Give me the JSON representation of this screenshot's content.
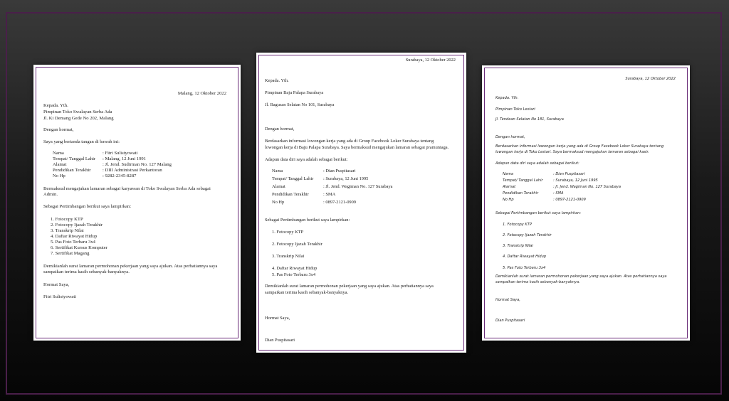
{
  "letter1": {
    "date": "Malang, 12 Oktober 2022",
    "to_label": "Kepada. Yth.",
    "recipient": "Pimpinan Toko Swalayan Serba Ada",
    "address": "Jl. Ki Demang Gede No 202, Malang",
    "greeting": "Dengan hormat,",
    "intro": "Saya yang bertanda tangan di bawah ini:",
    "fields": [
      {
        "label": "Nama",
        "value": ": Fitri Sulistyowati"
      },
      {
        "label": "Tempat/ Tanggal Lahir",
        "value": ": Malang, 12 Juni 1991"
      },
      {
        "label": "Alamat",
        "value": ": Jl. Jend. Sudirman No. 127 Malang"
      },
      {
        "label": "Pendidikan Terakhir",
        "value": ": DIII Administrasi Perkantoran"
      },
      {
        "label": "No Hp",
        "value": ": 9282-2345-8287"
      }
    ],
    "body_line1": "Bermaksud mengajukan lamaran sebagai karyawan di Toko Swalayan Serba Ada sebagai",
    "body_line2": "Admin.",
    "attach_intro": "Sebagai Pertimbangan berikut saya lampirkan:",
    "attachments": [
      "1.  Fotocopy KTP",
      "2.  Fotocopy Ijazah Terakhir",
      "3.  Transkrip Nilai",
      "4.  Daftar Riwayat Hidup",
      "5.  Pas Foto Terbaru 3x4",
      "6.  Sertifikat Kursus Komputer",
      "7.  Sertifikat Magang"
    ],
    "closing_line1": "Demikianlah surat lamaran permohonan pekerjaan yang saya ajukan. Atas perhatiannya saya",
    "closing_line2": "sampaikan terima kasih sebanyak-banyaknya.",
    "regards": "Hormat Saya,",
    "signature": "Fitri Sulistyowati"
  },
  "letter2": {
    "date": "Surabaya, 12 Oktober 2022",
    "to_label": "Kepada. Yth.",
    "recipient": "Pimpinan Baju Palapa Surabaya",
    "address": "Jl. Bagusan Selatan No 101, Surabaya",
    "greeting": "Dengan hormat,",
    "body_line1": "Berdasarkan informasi lowongan kerja yang ada di Group Facebook Loker Surabaya tentang",
    "body_line2": "lowongan kerja di Baju Palapa Surabaya. Saya bermaksud mengajukan lamaran sebagai pramuniaga.",
    "intro": "Adapun data diri saya adalah sebagai berikut:",
    "fields": [
      {
        "label": "Nama",
        "value": ": Dian Puspitasari"
      },
      {
        "label": "Tempat/ Tanggal Lahir",
        "value": ": Surabaya, 12 Juni 1995"
      },
      {
        "label": "Alamat",
        "value": ": Jl. Jend. Wagiman No. 127 Surabaya"
      },
      {
        "label": "Pendidikan Terakhir",
        "value": ": SMA"
      },
      {
        "label": "No Hp",
        "value": ": 0897-2121-0909"
      }
    ],
    "attach_intro": "Sebagai Pertimbangan berikut saya lampirkan:",
    "attachments": [
      "1.  Fotocopy KTP",
      "2.  Fotocopy Ijazah Terakhir",
      "3.  Transkrip Nilai",
      "4.  Daftar Riwayat Hidup",
      "5.  Pas Foto Terbaru 3x4"
    ],
    "closing_line1": "Demikianlah surat lamaran permohonan pekerjaan yang saya ajukan. Atas perhatiannya saya",
    "closing_line2": "sampaikan terima kasih sebanyak-banyaknya.",
    "regards": "Hormat Saya,",
    "signature": "Dian Puspitasari"
  },
  "letter3": {
    "date": "Surabaya, 12 Oktober 2022",
    "to_label": "Kepada. Yth.",
    "recipient": "Pimpinan Toko Lestari",
    "address": "Jl. Tendean Selatan No 181, Surabaya",
    "greeting": "Dengan hormat,",
    "body_line1": "Berdasarkan informasi lowongan kerja yang ada di Group Facebook Loker Surabaya tentang",
    "body_line2": "lowongan kerja di Toko Lestari. Saya bermaksud mengajukan lamaran sebagai kasir.",
    "intro": "Adapun data diri saya adalah sebagai berikut:",
    "fields": [
      {
        "label": "Nama",
        "value": ": Dian Puspitasari"
      },
      {
        "label": "Tempat/ Tanggal Lahir",
        "value": ": Surabaya, 12 Juni 1995"
      },
      {
        "label": "Alamat",
        "value": ": Jl. Jend. Wagiman No. 127 Surabaya"
      },
      {
        "label": "Pendidikan Terakhir",
        "value": ": SMA"
      },
      {
        "label": "No Hp",
        "value": ": 0897-2121-0909"
      }
    ],
    "attach_intro": "Sebagai Pertimbangan berikut saya lampirkan:",
    "attachments": [
      "1.  Fotocopy KTP",
      "2.  Fotocopy Ijazah Terakhir",
      "3.  Transkrip Nilai",
      "4.  Daftar Riwayat Hidup",
      "5.  Pas Foto Terbaru 3x4"
    ],
    "closing_line1": "Demikianlah surat lamaran permohonan pekerjaan yang saya ajukan. Atas perhatiannya saya",
    "closing_line2": "sampaikan terima kasih sebanyak-banyaknya.",
    "regards": "Hormat Saya,",
    "signature": "Dian Puspitasari"
  }
}
